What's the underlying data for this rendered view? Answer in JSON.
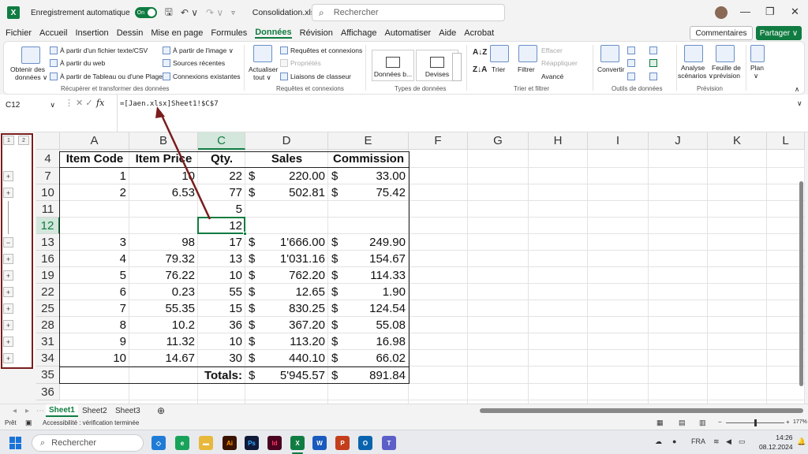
{
  "titlebar": {
    "app_logo": "X",
    "autosave_label": "Enregistrement automatique",
    "autosave_state": "On",
    "save_icon": "save-icon",
    "undo_icon": "undo-icon",
    "redo_icon": "redo-icon",
    "doc_title": "Consolidation.xlsx • Enregistré ∨",
    "search_placeholder": "Rechercher",
    "minimize": "—",
    "maximize": "❐",
    "close": "✕"
  },
  "menu": {
    "items": [
      "Fichier",
      "Accueil",
      "Insertion",
      "Dessin",
      "Mise en page",
      "Formules",
      "Données",
      "Révision",
      "Affichage",
      "Automatiser",
      "Aide",
      "Acrobat"
    ],
    "active": "Données",
    "comments_label": "Commentaires",
    "share_label": "Partager ∨"
  },
  "ribbon": {
    "get_data_1": "Obtenir des",
    "get_data_2": "données ∨",
    "from_text": "À partir d'un fichier texte/CSV",
    "from_web": "À partir du web",
    "from_table": "À partir de Tableau ou d'une Plage",
    "from_image": "À partir de l'image ∨",
    "recent_sources": "Sources récentes",
    "existing_connections": "Connexions existantes",
    "group1_label": "Récupérer et transformer des données",
    "refresh_1": "Actualiser",
    "refresh_2": "tout ∨",
    "queries_connections": "Requêtes et connexions",
    "properties": "Propriétés",
    "workbook_links": "Liaisons de classeur",
    "group2_label": "Requêtes et connexions",
    "dtype_stocks": "Données b...",
    "dtype_currencies": "Devises",
    "group3_label": "Types de données",
    "sort": "Trier",
    "filter": "Filtrer",
    "clear": "Effacer",
    "reapply": "Réappliquer",
    "advanced": "Avancé",
    "group4_label": "Trier et filtrer",
    "convert": "Convertir",
    "group5_label": "Outils de données",
    "whatif_1": "Analyse",
    "whatif_2": "scénarios ∨",
    "forecast_1": "Feuille de",
    "forecast_2": "prévision",
    "group6_label": "Prévision",
    "outline": "Plan",
    "outline_2": "∨"
  },
  "formula_bar": {
    "name_box": "C12",
    "formula": "=[Jaen.xlsx]Sheet1!$C$7",
    "fx_label": "fx"
  },
  "outline": {
    "levels": [
      "1",
      "2"
    ],
    "buttons": [
      "+",
      "+",
      "−",
      "+",
      "+",
      "+",
      "+",
      "+",
      "+",
      "+"
    ]
  },
  "grid": {
    "columns": [
      "A",
      "B",
      "C",
      "D",
      "E",
      "F",
      "G",
      "H",
      "I",
      "J",
      "K",
      "L"
    ],
    "selected_column": "C",
    "selected_row": "12",
    "rows": [
      {
        "num": "4",
        "a": "Item Code",
        "b": "Item Price",
        "c": "Qty.",
        "d_cur": "",
        "d": "Sales",
        "e_cur": "",
        "e": "Commission",
        "header": true
      },
      {
        "num": "7",
        "a": "1",
        "b": "10",
        "c": "22",
        "d_cur": "$",
        "d": "220.00",
        "e_cur": "$",
        "e": "33.00"
      },
      {
        "num": "10",
        "a": "2",
        "b": "6.53",
        "c": "77",
        "d_cur": "$",
        "d": "502.81",
        "e_cur": "$",
        "e": "75.42"
      },
      {
        "num": "11",
        "a": "",
        "b": "",
        "c": "5",
        "d_cur": "",
        "d": "",
        "e_cur": "",
        "e": ""
      },
      {
        "num": "12",
        "a": "",
        "b": "",
        "c": "12",
        "d_cur": "",
        "d": "",
        "e_cur": "",
        "e": ""
      },
      {
        "num": "13",
        "a": "3",
        "b": "98",
        "c": "17",
        "d_cur": "$",
        "d": "1'666.00",
        "e_cur": "$",
        "e": "249.90"
      },
      {
        "num": "16",
        "a": "4",
        "b": "79.32",
        "c": "13",
        "d_cur": "$",
        "d": "1'031.16",
        "e_cur": "$",
        "e": "154.67"
      },
      {
        "num": "19",
        "a": "5",
        "b": "76.22",
        "c": "10",
        "d_cur": "$",
        "d": "762.20",
        "e_cur": "$",
        "e": "114.33"
      },
      {
        "num": "22",
        "a": "6",
        "b": "0.23",
        "c": "55",
        "d_cur": "$",
        "d": "12.65",
        "e_cur": "$",
        "e": "1.90"
      },
      {
        "num": "25",
        "a": "7",
        "b": "55.35",
        "c": "15",
        "d_cur": "$",
        "d": "830.25",
        "e_cur": "$",
        "e": "124.54"
      },
      {
        "num": "28",
        "a": "8",
        "b": "10.2",
        "c": "36",
        "d_cur": "$",
        "d": "367.20",
        "e_cur": "$",
        "e": "55.08"
      },
      {
        "num": "31",
        "a": "9",
        "b": "11.32",
        "c": "10",
        "d_cur": "$",
        "d": "113.20",
        "e_cur": "$",
        "e": "16.98"
      },
      {
        "num": "34",
        "a": "10",
        "b": "14.67",
        "c": "30",
        "d_cur": "$",
        "d": "440.10",
        "e_cur": "$",
        "e": "66.02"
      },
      {
        "num": "35",
        "a": "",
        "b": "",
        "c": "Totals:",
        "d_cur": "$",
        "d": "5'945.57",
        "e_cur": "$",
        "e": "891.84",
        "totals": true
      },
      {
        "num": "36",
        "a": "",
        "b": "",
        "c": "",
        "d_cur": "",
        "d": "",
        "e_cur": "",
        "e": ""
      }
    ]
  },
  "sheets": {
    "tabs": [
      "Sheet1",
      "Sheet2",
      "Sheet3"
    ],
    "active": "Sheet1",
    "add": "⊕"
  },
  "status": {
    "ready": "Prêt",
    "accessibility": "Accessibilité : vérification terminée",
    "zoom": "177%"
  },
  "taskbar": {
    "search_placeholder": "Rechercher",
    "lang": "FRA",
    "time": "14:26",
    "date": "08.12.2024"
  },
  "colors": {
    "excel_green": "#107c41",
    "annotation": "#7a1d1d"
  }
}
